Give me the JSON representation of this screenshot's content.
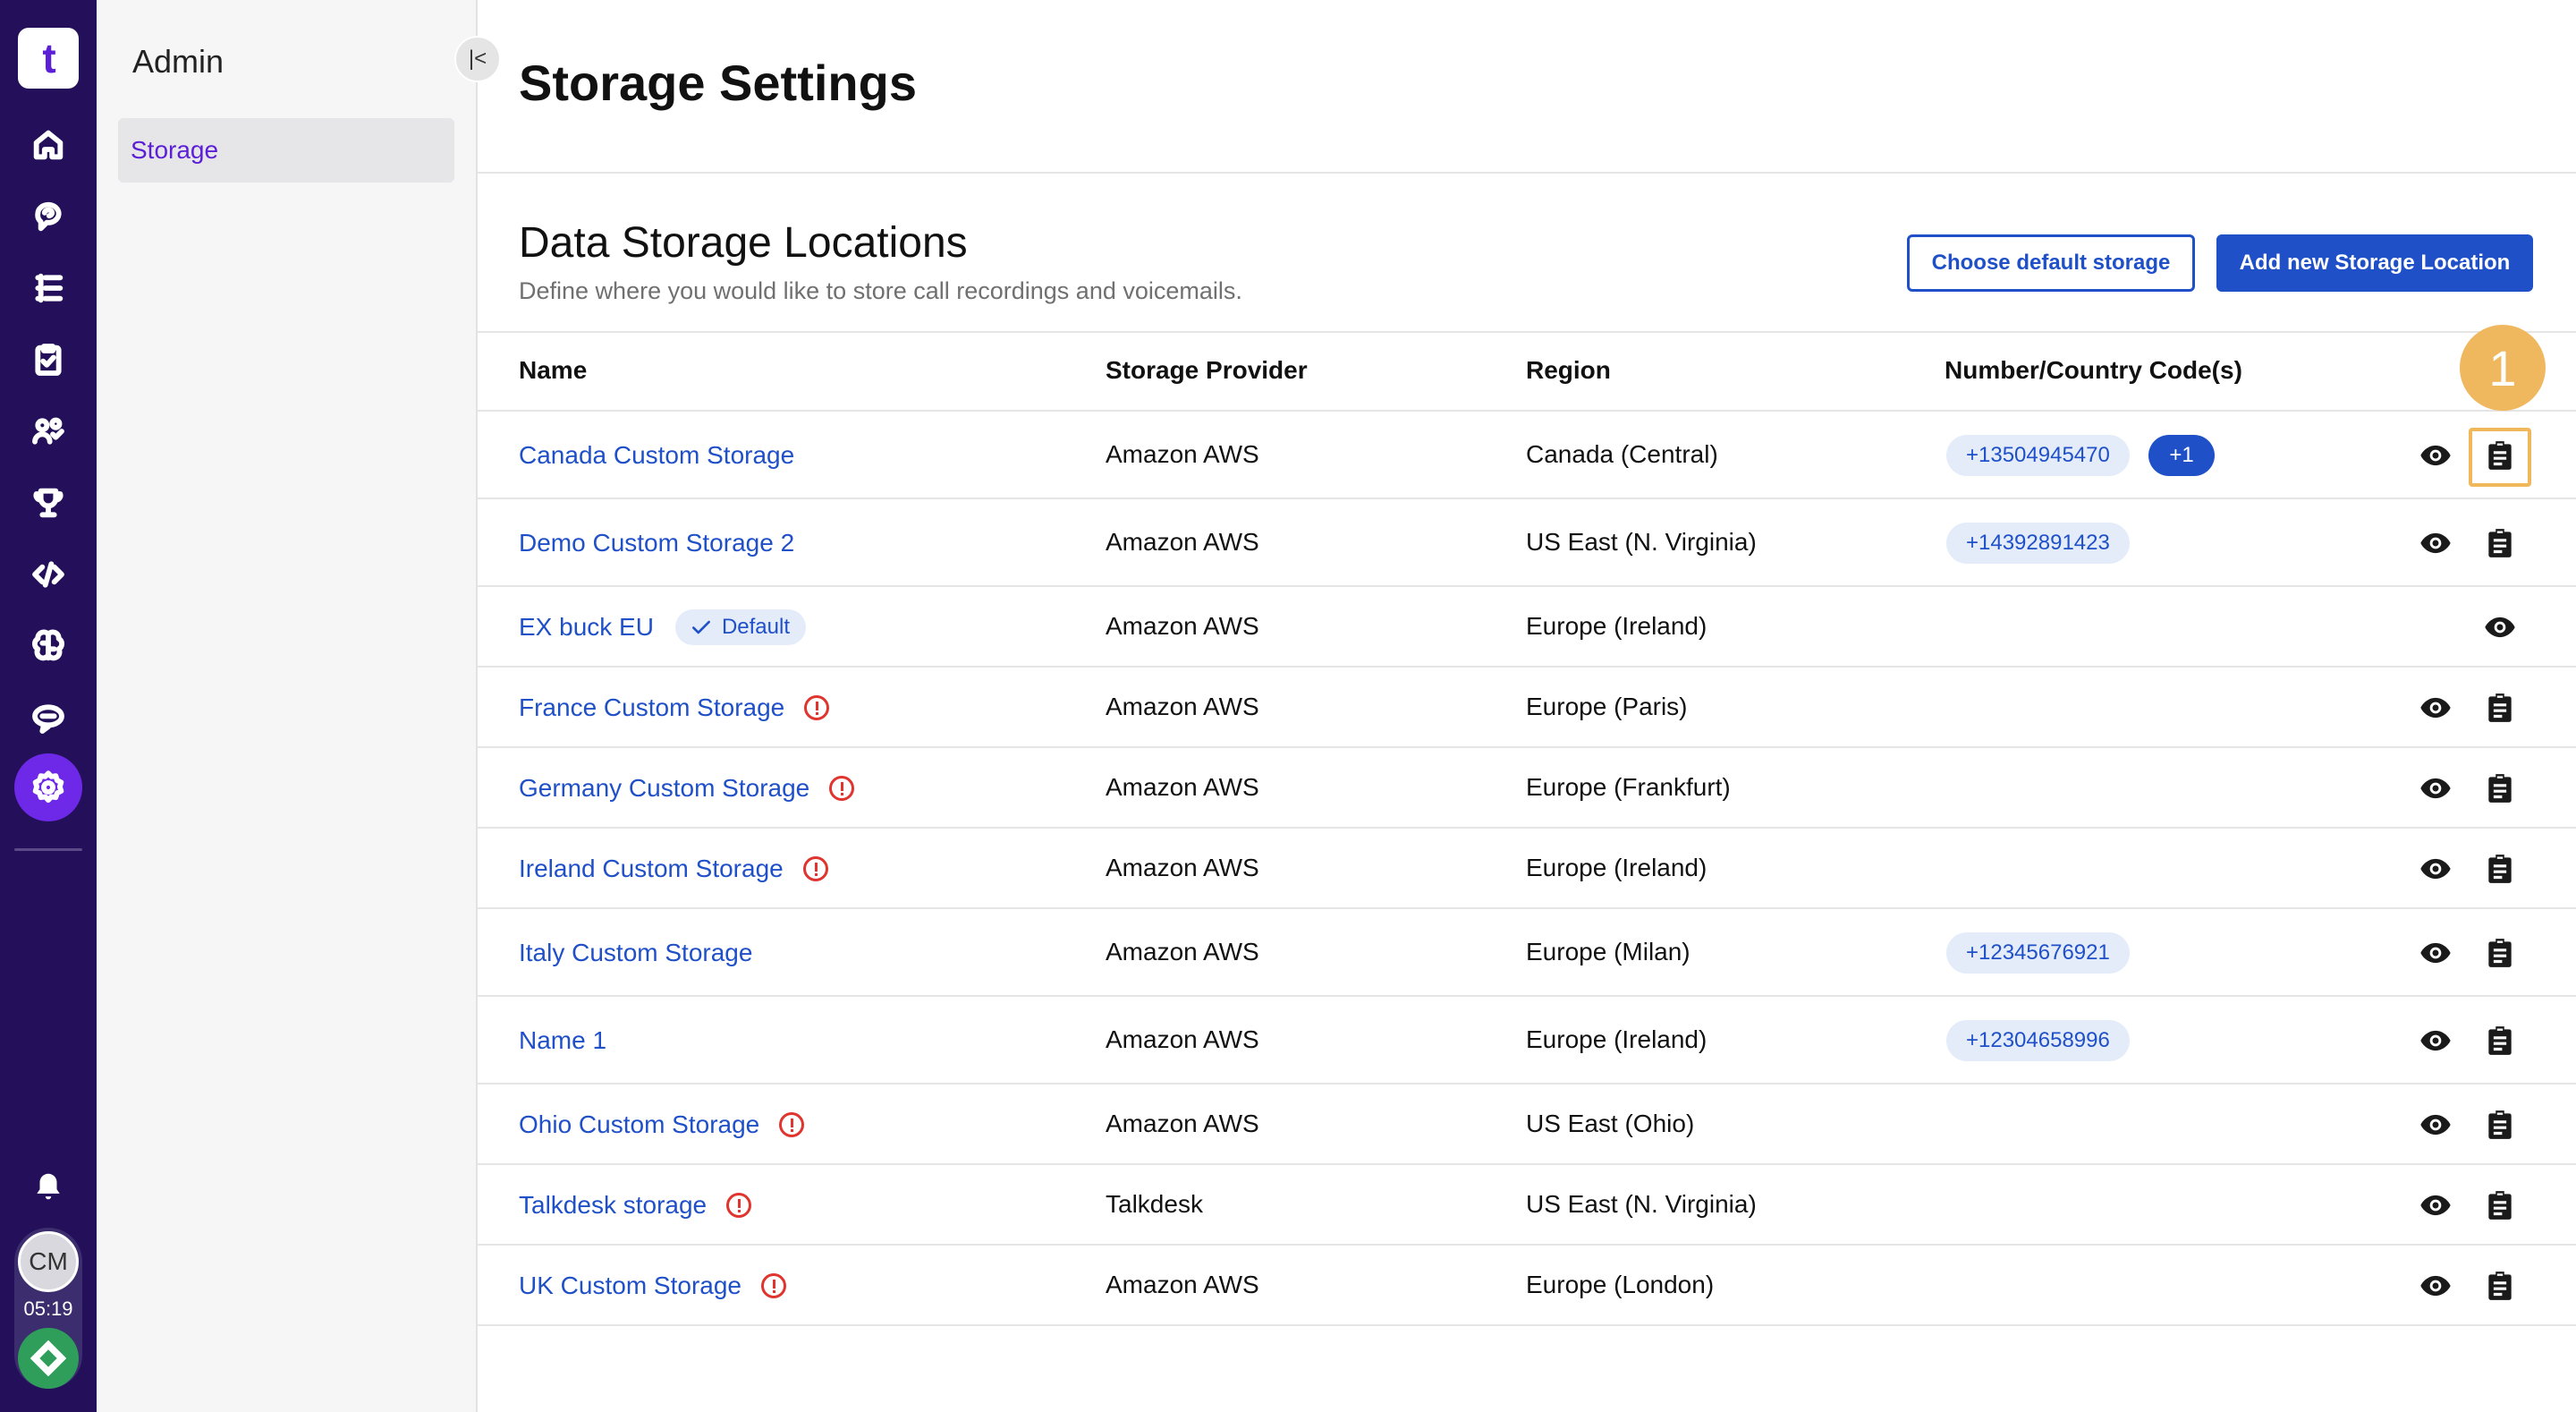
{
  "app": {
    "logo_text": "t",
    "clock": "05:19",
    "user_initials": "CM"
  },
  "rail": {
    "items": [
      {
        "name": "home-icon"
      },
      {
        "name": "conversations-icon"
      },
      {
        "name": "list-icon"
      },
      {
        "name": "clipboard-icon"
      },
      {
        "name": "people-icon"
      },
      {
        "name": "trophy-icon"
      },
      {
        "name": "code-icon"
      },
      {
        "name": "ai-brain-icon"
      },
      {
        "name": "chat-icon"
      }
    ],
    "active": "gear-icon"
  },
  "sidebar": {
    "title": "Admin",
    "items": [
      {
        "label": "Storage",
        "active": true
      }
    ]
  },
  "page": {
    "title": "Storage Settings",
    "section_title": "Data Storage Locations",
    "section_subtitle": "Define where you would like to store call recordings and voicemails.",
    "choose_default_label": "Choose default storage",
    "add_new_label": "Add new Storage Location",
    "step_badge": "1"
  },
  "table": {
    "headers": {
      "name": "Name",
      "provider": "Storage Provider",
      "region": "Region",
      "numbers": "Number/Country Code(s)"
    },
    "rows": [
      {
        "name": "Canada Custom Storage",
        "provider": "Amazon AWS",
        "region": "Canada (Central)",
        "number": "+13504945470",
        "more": "+1",
        "warning": false,
        "default": false
      },
      {
        "name": "Demo Custom Storage 2",
        "provider": "Amazon AWS",
        "region": "US East (N. Virginia)",
        "number": "+14392891423",
        "warning": false,
        "default": false
      },
      {
        "name": "EX buck EU",
        "provider": "Amazon AWS",
        "region": "Europe (Ireland)",
        "default_label": "Default",
        "warning": false,
        "default": true
      },
      {
        "name": "France Custom Storage",
        "provider": "Amazon AWS",
        "region": "Europe (Paris)",
        "warning": true,
        "default": false
      },
      {
        "name": "Germany Custom Storage",
        "provider": "Amazon AWS",
        "region": "Europe (Frankfurt)",
        "warning": true,
        "default": false
      },
      {
        "name": "Ireland Custom Storage",
        "provider": "Amazon AWS",
        "region": "Europe (Ireland)",
        "warning": true,
        "default": false
      },
      {
        "name": "Italy Custom Storage",
        "provider": "Amazon AWS",
        "region": "Europe (Milan)",
        "number": "+12345676921",
        "warning": false,
        "default": false
      },
      {
        "name": "Name 1",
        "provider": "Amazon AWS",
        "region": "Europe (Ireland)",
        "number": "+12304658996",
        "warning": false,
        "default": false
      },
      {
        "name": "Ohio Custom Storage",
        "provider": "Amazon AWS",
        "region": "US East (Ohio)",
        "warning": true,
        "default": false
      },
      {
        "name": "Talkdesk storage",
        "provider": "Talkdesk",
        "region": "US East (N. Virginia)",
        "warning": true,
        "default": false
      },
      {
        "name": "UK Custom Storage",
        "provider": "Amazon AWS",
        "region": "Europe (London)",
        "warning": true,
        "default": false
      }
    ]
  },
  "colors": {
    "rail": "#24105a",
    "accent": "#1f50c8",
    "active_rail": "#6d28e8",
    "warning": "#e0342e",
    "highlight": "#efb85f"
  }
}
